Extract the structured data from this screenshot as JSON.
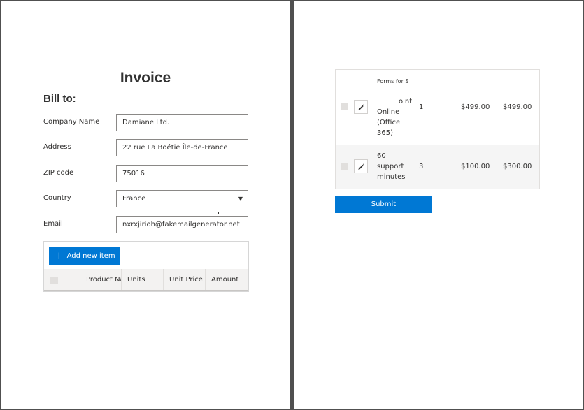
{
  "invoice": {
    "title": "Invoice",
    "bill_to": "Bill to:",
    "fields": {
      "company_label": "Company Name",
      "company_value": "Damiane Ltd.",
      "address_label": "Address",
      "address_value": "22 rue La Boétie Île-de-France",
      "zip_label": "ZIP code",
      "zip_value": "75016",
      "country_label": "Country",
      "country_value": "France",
      "email_label": "Email",
      "email_value": "nxrxjirioh@fakemailgenerator.net"
    },
    "add_item_label": "Add new item",
    "columns": {
      "product": "Product Na",
      "units": "Units",
      "unit_price": "Unit Price",
      "amount": "Amount"
    }
  },
  "items": [
    {
      "product_top": "Forms for S",
      "product_mid": "oint",
      "product_rest": "Online (Office 365)",
      "units": "1",
      "unit_price": "$499.00",
      "amount": "$499.00"
    },
    {
      "product_top": "",
      "product_mid": "",
      "product_rest": "60 support minutes",
      "units": "3",
      "unit_price": "$100.00",
      "amount": "$300.00"
    }
  ],
  "submit_label": "Submit",
  "colors": {
    "accent": "#0078d4",
    "page_background": "#505050",
    "header_background": "#f3f2f1"
  },
  "icons": {
    "add": "plus-icon",
    "dropdown": "chevron-down-icon",
    "edit": "pencil-icon"
  }
}
